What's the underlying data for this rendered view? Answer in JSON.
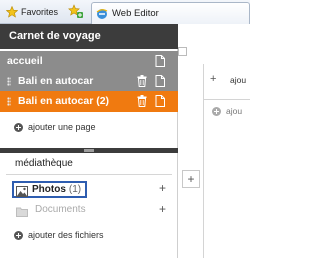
{
  "browser": {
    "favorites_label": "Favorites",
    "tab_title": "Web Editor"
  },
  "sidebar": {
    "title": "Carnet de voyage",
    "pages": [
      {
        "label": "accueil"
      },
      {
        "label": "Bali en autocar"
      },
      {
        "label": "Bali en autocar (2)"
      }
    ],
    "add_page_label": "ajouter une page"
  },
  "media": {
    "title": "médiathèque",
    "photos_label": "Photos",
    "photos_count": "(1)",
    "documents_label": "Documents",
    "add_files_label": "ajouter des fichiers"
  },
  "right_panel": {
    "add_label_1": "ajou",
    "add_label_2": "ajou"
  },
  "colors": {
    "header_dark": "#3c3c3c",
    "page_row_gray": "#8c8c8c",
    "active_page_orange": "#f07a10",
    "selection_blue": "#2e5db0"
  }
}
